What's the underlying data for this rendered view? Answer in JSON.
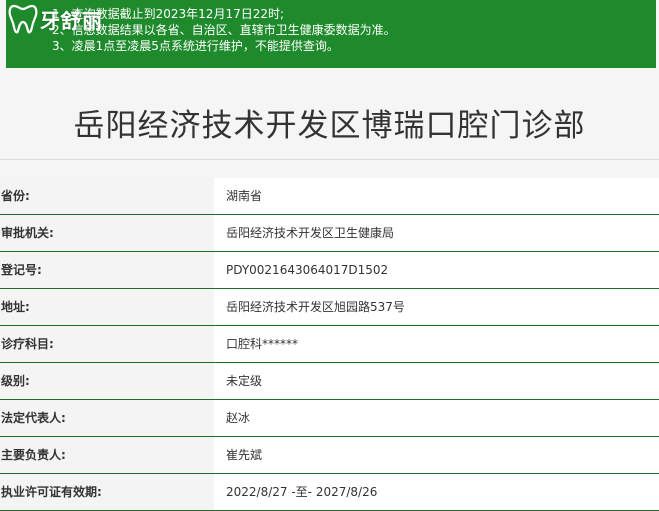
{
  "colors": {
    "notice_bg": "#1e8a2c",
    "row_border": "#1e6b2a",
    "label_bg": "#f4f4f4",
    "value_bg": "#ffffff"
  },
  "logo": {
    "icon": "tooth-icon",
    "text": "牙舒丽"
  },
  "notice": {
    "lines": [
      "1、查询数据截止到2023年12月17日22时;",
      "2、信息数据结果以各省、自治区、直辖市卫生健康委数据为准。",
      "3、凌晨1点至凌晨5点系统进行维护，不能提供查询。"
    ]
  },
  "page": {
    "title": "岳阳经济技术开发区博瑞口腔门诊部"
  },
  "info": {
    "rows": [
      {
        "label": "省份:",
        "value": "湖南省"
      },
      {
        "label": "审批机关:",
        "value": "岳阳经济技术开发区卫生健康局"
      },
      {
        "label": "登记号:",
        "value": "PDY0021643064017D1502"
      },
      {
        "label": "地址:",
        "value": "岳阳经济技术开发区旭园路537号"
      },
      {
        "label": "诊疗科目:",
        "value": "口腔科******"
      },
      {
        "label": "级别:",
        "value": "未定级"
      },
      {
        "label": "法定代表人:",
        "value": "赵冰"
      },
      {
        "label": "主要负责人:",
        "value": "崔先斌"
      },
      {
        "label": "执业许可证有效期:",
        "value": "2022/8/27 -至- 2027/8/26"
      }
    ]
  }
}
